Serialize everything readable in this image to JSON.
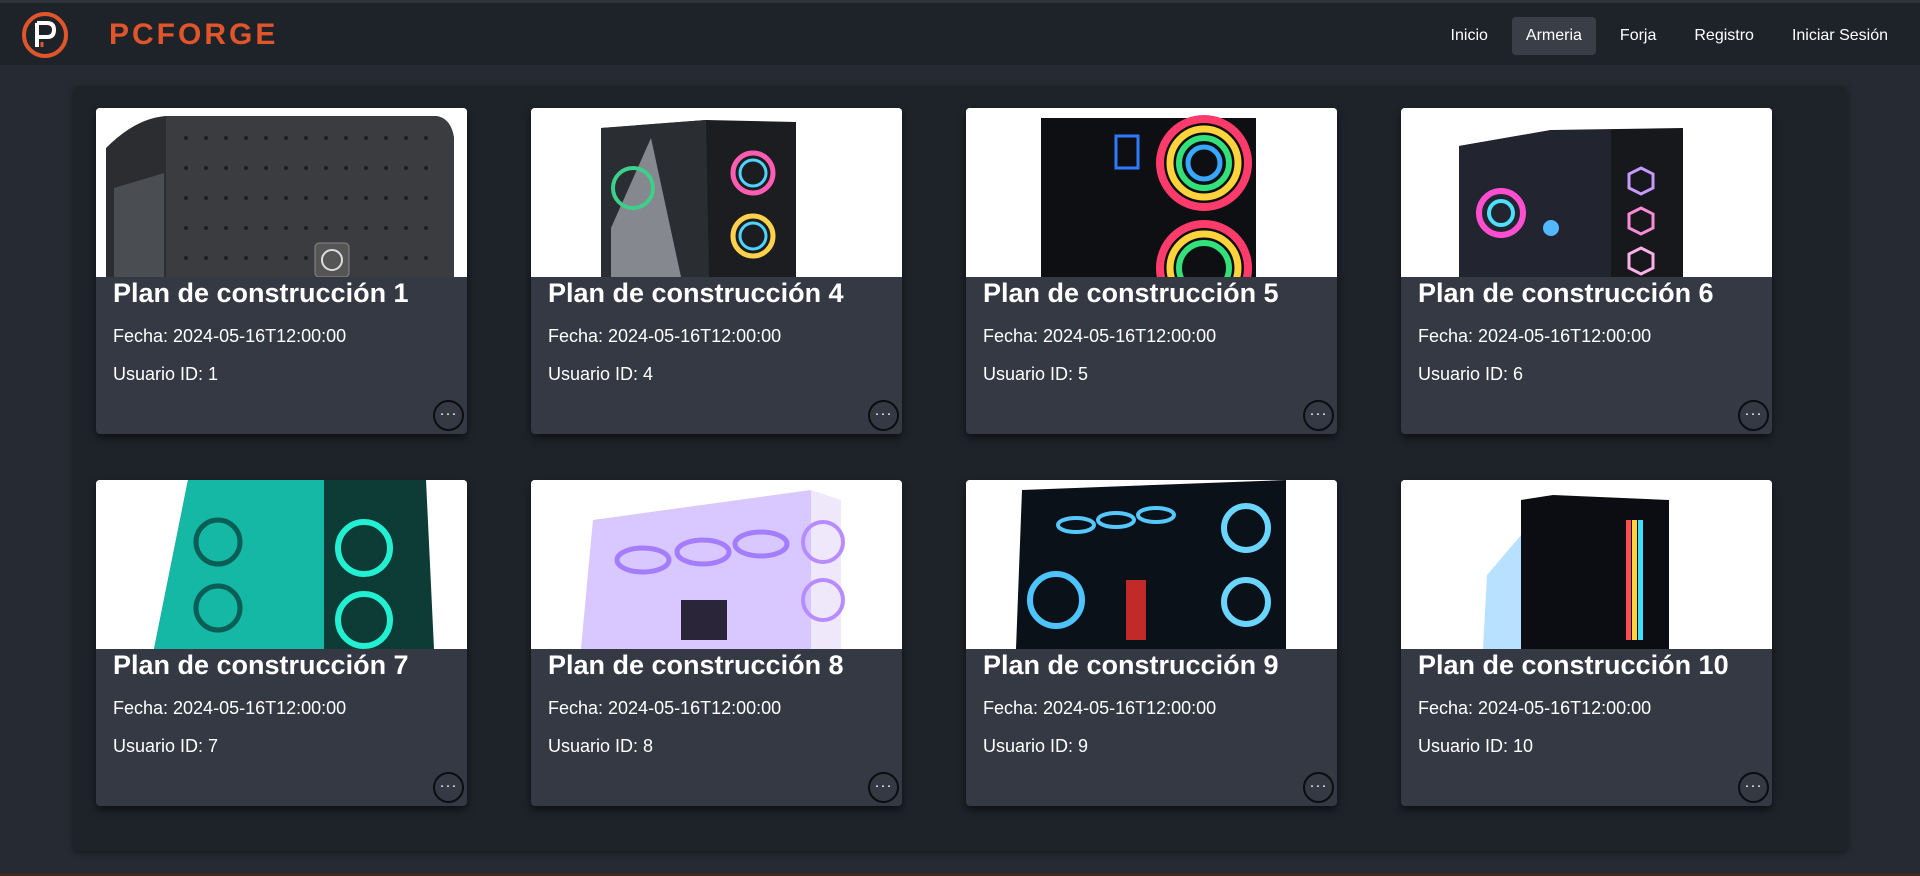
{
  "brand": {
    "name": "PCFORGE",
    "logo_letter": "P",
    "accent_color": "#e0552a"
  },
  "nav": {
    "items": [
      {
        "label": "Inicio",
        "active": false
      },
      {
        "label": "Armeria",
        "active": true
      },
      {
        "label": "Forja",
        "active": false
      },
      {
        "label": "Registro",
        "active": false
      },
      {
        "label": "Iniciar Sesión",
        "active": false
      }
    ]
  },
  "cards": [
    {
      "title": "Plan de construcción 1",
      "date": "Fecha: 2024-05-16T12:00:00",
      "user": "Usuario ID: 1",
      "image": "pc-case-mesh-thermaltake",
      "menu": "···"
    },
    {
      "title": "Plan de construcción 4",
      "date": "Fecha: 2024-05-16T12:00:00",
      "user": "Usuario ID: 4",
      "image": "pc-case-rgb-glass",
      "menu": "···"
    },
    {
      "title": "Plan de construcción 5",
      "date": "Fecha: 2024-05-16T12:00:00",
      "user": "Usuario ID: 5",
      "image": "pc-case-rainbow-fans",
      "menu": "···"
    },
    {
      "title": "Plan de construcción 6",
      "date": "Fecha: 2024-05-16T12:00:00",
      "user": "Usuario ID: 6",
      "image": "pc-case-rgb-hex",
      "menu": "···"
    },
    {
      "title": "Plan de construcción 7",
      "date": "Fecha: 2024-05-16T12:00:00",
      "user": "Usuario ID: 7",
      "image": "pc-case-teal",
      "menu": "···"
    },
    {
      "title": "Plan de construcción 8",
      "date": "Fecha: 2024-05-16T12:00:00",
      "user": "Usuario ID: 8",
      "image": "pc-case-white-purple",
      "menu": "···"
    },
    {
      "title": "Plan de construcción 9",
      "date": "Fecha: 2024-05-16T12:00:00",
      "user": "Usuario ID: 9",
      "image": "pc-case-blue-fans",
      "menu": "···"
    },
    {
      "title": "Plan de construcción 10",
      "date": "Fecha: 2024-05-16T12:00:00",
      "user": "Usuario ID: 10",
      "image": "pc-case-black-rgb-strip",
      "menu": "···"
    }
  ]
}
